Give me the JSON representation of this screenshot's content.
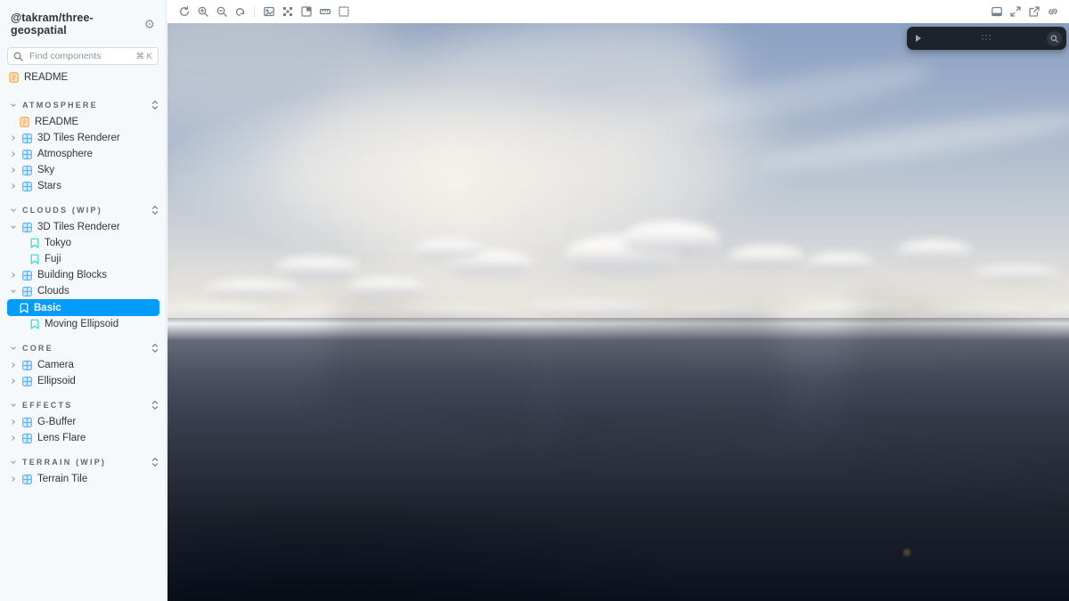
{
  "sidebar": {
    "title": "@takram/three-geospatial",
    "search": {
      "placeholder": "Find components",
      "shortcut": "⌘ K"
    },
    "root_items": [
      {
        "label": "README",
        "type": "doc"
      }
    ],
    "sections": [
      {
        "label": "ATMOSPHERE",
        "items": [
          {
            "label": "README",
            "type": "doc"
          },
          {
            "label": "3D Tiles Renderer",
            "type": "component",
            "state": "collapsed"
          },
          {
            "label": "Atmosphere",
            "type": "component",
            "state": "collapsed"
          },
          {
            "label": "Sky",
            "type": "component",
            "state": "collapsed"
          },
          {
            "label": "Stars",
            "type": "component",
            "state": "collapsed"
          }
        ]
      },
      {
        "label": "CLOUDS (WIP)",
        "items": [
          {
            "label": "3D Tiles Renderer",
            "type": "component",
            "state": "expanded"
          },
          {
            "label": "Tokyo",
            "type": "story"
          },
          {
            "label": "Fuji",
            "type": "story"
          },
          {
            "label": "Building Blocks",
            "type": "component",
            "state": "collapsed"
          },
          {
            "label": "Clouds",
            "type": "component",
            "state": "expanded"
          },
          {
            "label": "Basic",
            "type": "story",
            "selected": true
          },
          {
            "label": "Moving Ellipsoid",
            "type": "story"
          }
        ]
      },
      {
        "label": "CORE",
        "items": [
          {
            "label": "Camera",
            "type": "component",
            "state": "collapsed"
          },
          {
            "label": "Ellipsoid",
            "type": "component",
            "state": "collapsed"
          }
        ]
      },
      {
        "label": "EFFECTS",
        "items": [
          {
            "label": "G-Buffer",
            "type": "component",
            "state": "collapsed"
          },
          {
            "label": "Lens Flare",
            "type": "component",
            "state": "collapsed"
          }
        ]
      },
      {
        "label": "TERRAIN (WIP)",
        "items": [
          {
            "label": "Terrain Tile",
            "type": "component",
            "state": "collapsed"
          }
        ]
      }
    ]
  },
  "toolbar": {
    "left_icons": [
      "remount-icon",
      "zoom-in-icon",
      "zoom-out-icon",
      "zoom-reset-icon",
      "backgrounds-icon",
      "grid-icon",
      "viewport-icon",
      "measure-icon",
      "outline-icon"
    ],
    "right_icons": [
      "addon-panel-icon",
      "fullscreen-icon",
      "open-new-tab-icon",
      "copy-link-icon"
    ]
  },
  "leva_bar": {
    "icons": [
      "collapse-play-icon",
      "drag-handle-dots",
      "filter-magnifier-icon"
    ]
  },
  "scene": {
    "description": "3D atmospheric render: hazy sun and cumulus clouds over a dark ocean, bright horizon band"
  },
  "colors": {
    "accent": "#029CFD",
    "selected_bg": "#029CFD",
    "component_icon": "#5AB0F7",
    "story_icon": "#37D5D3",
    "doc_icon": "#FF9D2B",
    "sidebar_bg": "#F6F9FC",
    "leva_bg": "#1E222A",
    "sky_top": "#8AA0C2",
    "ocean_bottom": "#0A111C"
  }
}
